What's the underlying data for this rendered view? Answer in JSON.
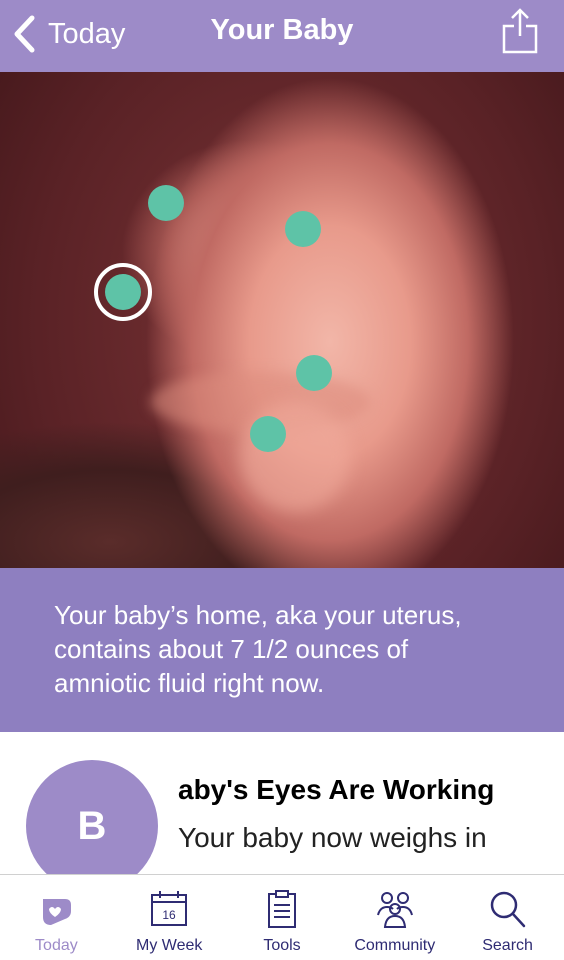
{
  "nav": {
    "back_label": "Today",
    "title": "Your Baby",
    "back_icon": "chevron-left-icon",
    "share_icon": "share-icon"
  },
  "hero": {
    "hotspots": [
      {
        "id": "a",
        "selected": false
      },
      {
        "id": "b",
        "selected": false
      },
      {
        "id": "c",
        "selected": true
      },
      {
        "id": "d",
        "selected": false
      },
      {
        "id": "e",
        "selected": false
      }
    ]
  },
  "fact": {
    "text": "Your baby’s home, aka your uterus, contains about 7 1/2 ounces of amniotic fluid right now."
  },
  "card": {
    "avatar_letter": "B",
    "title": "aby's Eyes Are Working",
    "body": "Your baby now weighs in"
  },
  "tabs": [
    {
      "label": "Today",
      "icon": "today-icon",
      "active": true
    },
    {
      "label": "My Week",
      "icon": "calendar-icon",
      "calendar_day": "16",
      "active": false
    },
    {
      "label": "Tools",
      "icon": "clipboard-icon",
      "active": false
    },
    {
      "label": "Community",
      "icon": "people-icon",
      "active": false
    },
    {
      "label": "Search",
      "icon": "search-icon",
      "active": false
    }
  ],
  "colors": {
    "brand": "#9d8bc8",
    "fact_bg": "#8e7fc0",
    "hotspot": "#5ec3a7",
    "tab_text": "#2f2c73"
  }
}
